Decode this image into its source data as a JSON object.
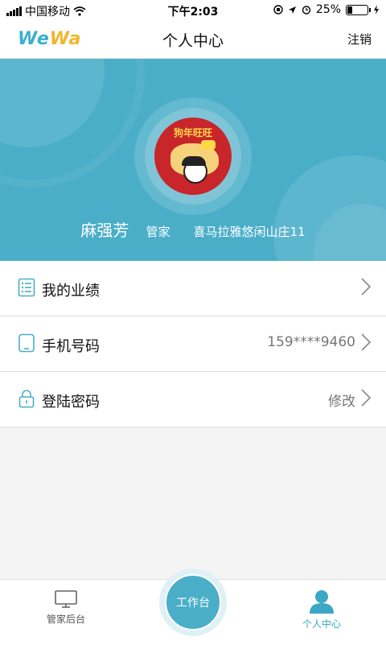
{
  "status_bar": {
    "carrier": "中国移动",
    "time": "下午2:03",
    "battery": "25%",
    "battery_level": 0.25
  },
  "nav": {
    "logo_part1": "We",
    "logo_part2": "Wa",
    "title": "个人中心",
    "logout": "注销"
  },
  "profile": {
    "avatar_caption": "狗年旺旺",
    "name": "麻强芳",
    "role": "管家",
    "estate": "喜马拉雅悠闲山庄11"
  },
  "menu": [
    {
      "label": "我的业绩",
      "value": "",
      "icon": "list-icon"
    },
    {
      "label": "手机号码",
      "value": "159****9460",
      "icon": "tablet-icon"
    },
    {
      "label": "登陆密码",
      "value": "修改",
      "icon": "lock-icon"
    }
  ],
  "tabs": {
    "left": "管家后台",
    "center": "工作台",
    "right": "个人中心",
    "active": "right",
    "accent": "#4aaec8"
  }
}
